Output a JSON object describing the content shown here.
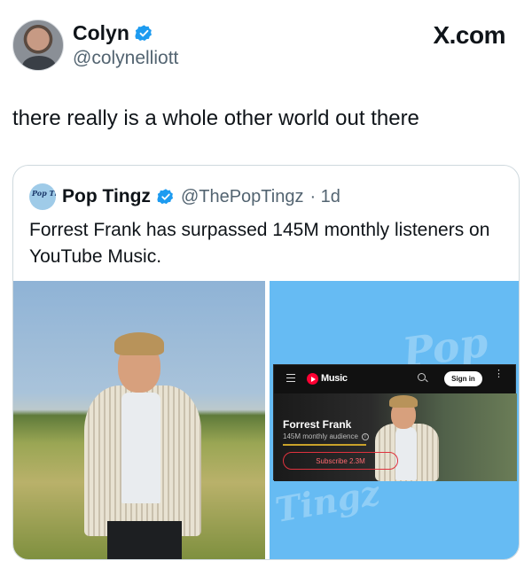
{
  "site_label": "X.com",
  "author": {
    "name": "Colyn",
    "handle": "@colynelliott",
    "avatar_icon": "profile-photo",
    "verified_color": "#1d9bf0"
  },
  "tweet": {
    "text": "there really is a whole other world out there"
  },
  "quoted_tweet": {
    "avatar_text": "Pop Tingz",
    "name": "Pop Tingz",
    "handle": "@ThePopTingz",
    "age": "· 1d",
    "text": "Forrest Frank has surpassed 145M monthly listeners on YouTube Music.",
    "watermark_top": "Pop",
    "watermark_bottom": "Tingz"
  },
  "youtube_music": {
    "logo_text": "Music",
    "sign_in_label": "Sign in",
    "artist_name": "Forrest Frank",
    "audience_text": "145M monthly audience",
    "info_icon_text": "i",
    "subscribe_label": "Subscribe 2.3M",
    "more_icon_text": "⋮"
  },
  "colors": {
    "right_panel_bg": "#66bbf3",
    "subscribe_accent": "#e0323e"
  }
}
